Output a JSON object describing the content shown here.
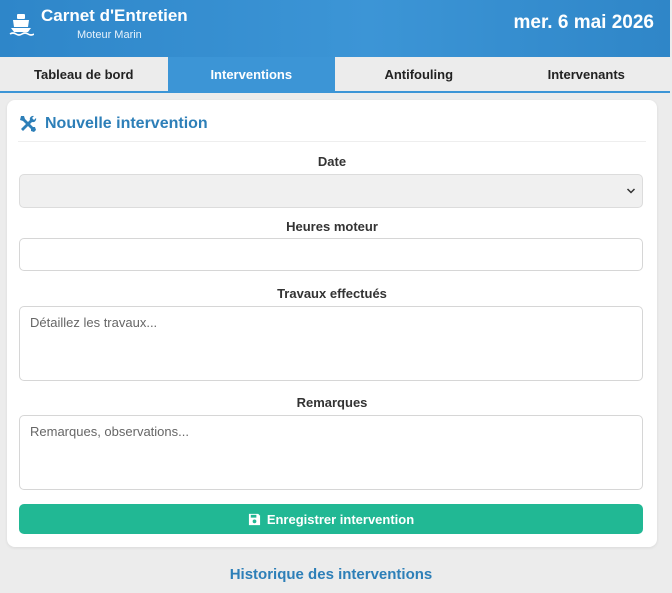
{
  "header": {
    "title": "Carnet d'Entretien",
    "subtitle": "Moteur Marin",
    "date": "mer. 6 mai 2026",
    "logo_icon": "ship-icon"
  },
  "tabs": [
    {
      "label": "Tableau de bord",
      "active": false
    },
    {
      "label": "Interventions",
      "active": true
    },
    {
      "label": "Antifouling",
      "active": false
    },
    {
      "label": "Intervenants",
      "active": false
    }
  ],
  "form": {
    "title": "Nouvelle intervention",
    "title_icon": "tools-icon",
    "date_label": "Date",
    "date_value": "",
    "hours_label": "Heures moteur",
    "hours_value": "",
    "work_label": "Travaux effectués",
    "work_placeholder": "Détaillez les travaux...",
    "remarks_label": "Remarques",
    "remarks_placeholder": "Remarques, observations...",
    "save_label": "Enregistrer intervention",
    "save_icon": "floppy-disk-icon"
  },
  "history": {
    "title": "Historique des interventions"
  },
  "colors": {
    "header": "#3c95d6",
    "accent_text": "#2d7fb8",
    "save_button": "#21b894",
    "background": "#ececec"
  }
}
